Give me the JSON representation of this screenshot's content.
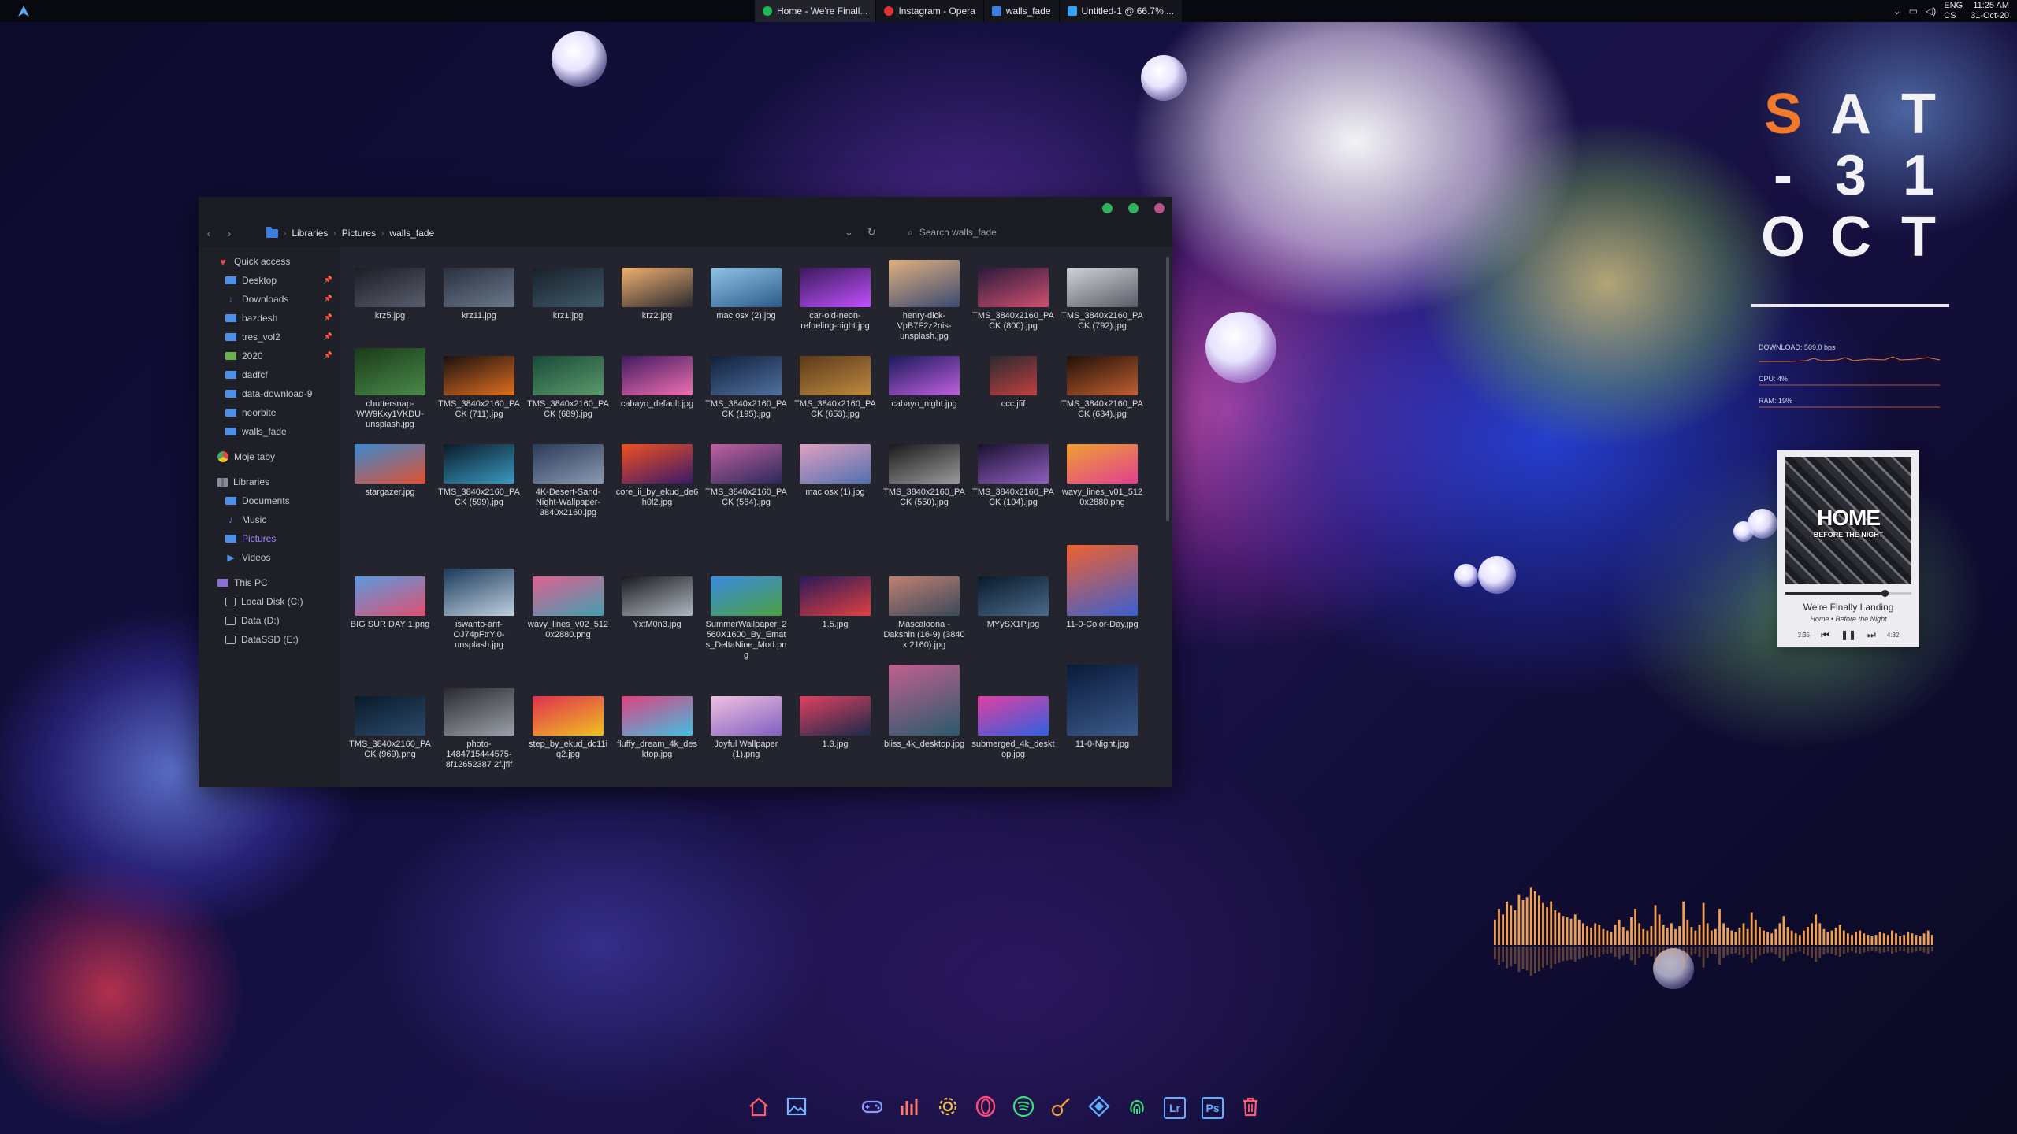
{
  "taskbar": {
    "tasks": [
      {
        "label": "Home - We're Finall...",
        "icon": "spotify-icon",
        "color": "#1db954"
      },
      {
        "label": "Instagram - Opera",
        "icon": "opera-icon",
        "color": "#e0322f"
      },
      {
        "label": "walls_fade",
        "icon": "folder-icon",
        "color": "#3b7fe0"
      },
      {
        "label": "Untitled-1 @ 66.7% ...",
        "icon": "photoshop-icon",
        "color": "#2fa3f7"
      }
    ],
    "lang_top": "ENG",
    "lang_bottom": "CS",
    "time": "11:25 AM",
    "date": "31-Oct-20"
  },
  "explorer": {
    "window_controls": [
      {
        "name": "minimize",
        "color": "#2fb35b"
      },
      {
        "name": "maximize",
        "color": "#2fb35b"
      },
      {
        "name": "close",
        "color": "#b8508a"
      }
    ],
    "breadcrumb": [
      "Libraries",
      "Pictures",
      "walls_fade"
    ],
    "search_placeholder": "Search walls_fade",
    "sidebar": [
      {
        "label": "Quick access",
        "kind": "heart",
        "level": 1
      },
      {
        "label": "Desktop",
        "kind": "folder",
        "level": 2,
        "pinned": true
      },
      {
        "label": "Downloads",
        "kind": "download",
        "level": 2,
        "pinned": true
      },
      {
        "label": "bazdesh",
        "kind": "folder",
        "level": 2,
        "pinned": true
      },
      {
        "label": "tres_vol2",
        "kind": "folder",
        "level": 2,
        "pinned": true
      },
      {
        "label": "2020",
        "kind": "image-folder",
        "level": 2,
        "pinned": true
      },
      {
        "label": "dadfcf",
        "kind": "folder",
        "level": 2
      },
      {
        "label": "data-download-9",
        "kind": "folder",
        "level": 2
      },
      {
        "label": "neorbite",
        "kind": "folder",
        "level": 2
      },
      {
        "label": "walls_fade",
        "kind": "folder",
        "level": 2
      },
      {
        "label": "Moje taby",
        "kind": "moje",
        "level": 1,
        "gap": true
      },
      {
        "label": "Libraries",
        "kind": "library",
        "level": 1,
        "gap": true
      },
      {
        "label": "Documents",
        "kind": "folder",
        "level": 2
      },
      {
        "label": "Music",
        "kind": "music",
        "level": 2
      },
      {
        "label": "Pictures",
        "kind": "folder",
        "level": 2,
        "selected": true
      },
      {
        "label": "Videos",
        "kind": "video",
        "level": 2
      },
      {
        "label": "This PC",
        "kind": "pc",
        "level": 1,
        "gap": true
      },
      {
        "label": "Local Disk (C:)",
        "kind": "drive",
        "level": 2
      },
      {
        "label": "Data (D:)",
        "kind": "drive",
        "level": 2
      },
      {
        "label": "DataSSD (E:)",
        "kind": "drive",
        "level": 2
      }
    ],
    "files": [
      {
        "name": "krz5.jpg",
        "c1": "#1b1d24",
        "c2": "#5a5f6e",
        "w": 90,
        "h": 50
      },
      {
        "name": "krz11.jpg",
        "c1": "#2a3040",
        "c2": "#6b7a8a",
        "w": 90,
        "h": 50
      },
      {
        "name": "krz1.jpg",
        "c1": "#18202a",
        "c2": "#3f5a6a",
        "w": 90,
        "h": 50
      },
      {
        "name": "krz2.jpg",
        "c1": "#f0b070",
        "c2": "#2a2a30",
        "w": 90,
        "h": 50
      },
      {
        "name": "mac osx (2).jpg",
        "c1": "#8fc4e6",
        "c2": "#2c5a8a",
        "w": 90,
        "h": 50
      },
      {
        "name": "car-old-neon-refueling-night.jpg",
        "c1": "#3a1a5a",
        "c2": "#c050ff",
        "w": 90,
        "h": 50
      },
      {
        "name": "henry-dick-VpB7F2z2nis-unsplash.jpg",
        "c1": "#e0b080",
        "c2": "#3a4a70",
        "w": 90,
        "h": 60
      },
      {
        "name": "TMS_3840x2160_PACK (800).jpg",
        "c1": "#2a1a3a",
        "c2": "#d05070",
        "w": 90,
        "h": 50
      },
      {
        "name": "TMS_3840x2160_PACK (792).jpg",
        "c1": "#cfd2d8",
        "c2": "#5a5c66",
        "w": 90,
        "h": 50
      },
      {
        "name": "chuttersnap-WW9Kxy1VKDU-unsplash.jpg",
        "c1": "#1a3a1a",
        "c2": "#4a8a4a",
        "w": 90,
        "h": 60
      },
      {
        "name": "TMS_3840x2160_PACK (711).jpg",
        "c1": "#1a1010",
        "c2": "#e07020",
        "w": 90,
        "h": 50
      },
      {
        "name": "TMS_3840x2160_PACK (689).jpg",
        "c1": "#1a4a3a",
        "c2": "#5a9a6a",
        "w": 90,
        "h": 50
      },
      {
        "name": "cabayo_default.jpg",
        "c1": "#401a60",
        "c2": "#f070b0",
        "w": 90,
        "h": 50
      },
      {
        "name": "TMS_3840x2160_PACK (195).jpg",
        "c1": "#10203a",
        "c2": "#5070a0",
        "w": 90,
        "h": 50
      },
      {
        "name": "TMS_3840x2160_PACK (653).jpg",
        "c1": "#5a3a1a",
        "c2": "#c08a40",
        "w": 90,
        "h": 50
      },
      {
        "name": "cabayo_night.jpg",
        "c1": "#1a1a5a",
        "c2": "#c060e0",
        "w": 90,
        "h": 50
      },
      {
        "name": "ccc.jfif",
        "c1": "#2a2a30",
        "c2": "#c04040",
        "w": 60,
        "h": 50
      },
      {
        "name": "TMS_3840x2160_PACK (634).jpg",
        "c1": "#201008",
        "c2": "#c06030",
        "w": 90,
        "h": 50
      },
      {
        "name": "stargazer.jpg",
        "c1": "#3a8ad0",
        "c2": "#e05030",
        "w": 90,
        "h": 50
      },
      {
        "name": "TMS_3840x2160_PACK (599).jpg",
        "c1": "#0a1a2a",
        "c2": "#3a9ac0",
        "w": 90,
        "h": 50
      },
      {
        "name": "4K-Desert-Sand-Night-Wallpaper-3840x2160.jpg",
        "c1": "#2a3a5a",
        "c2": "#8a9ab0",
        "w": 90,
        "h": 50
      },
      {
        "name": "core_ii_by_ekud_de6h0l2.jpg",
        "c1": "#f05020",
        "c2": "#3a1a6a",
        "w": 90,
        "h": 50
      },
      {
        "name": "TMS_3840x2160_PACK (564).jpg",
        "c1": "#c060a0",
        "c2": "#2a2a5a",
        "w": 90,
        "h": 50
      },
      {
        "name": "mac osx (1).jpg",
        "c1": "#e0a0c0",
        "c2": "#5070b0",
        "w": 90,
        "h": 50
      },
      {
        "name": "TMS_3840x2160_PACK (550).jpg",
        "c1": "#1a1a1a",
        "c2": "#9a9a9a",
        "w": 90,
        "h": 50
      },
      {
        "name": "TMS_3840x2160_PACK (104).jpg",
        "c1": "#1a1030",
        "c2": "#9060c0",
        "w": 90,
        "h": 50
      },
      {
        "name": "wavy_lines_v01_5120x2880.png",
        "c1": "#f0a030",
        "c2": "#e04090",
        "w": 90,
        "h": 50
      },
      {
        "name": "BIG SUR DAY 1.png",
        "c1": "#5a9ae0",
        "c2": "#e05070",
        "w": 90,
        "h": 50
      },
      {
        "name": "iswanto-arif-OJ74pFtrYi0-unsplash.jpg",
        "c1": "#1a3a5a",
        "c2": "#c0d0e0",
        "w": 90,
        "h": 60
      },
      {
        "name": "wavy_lines_v02_5120x2880.png",
        "c1": "#e06090",
        "c2": "#40a0b0",
        "w": 90,
        "h": 50
      },
      {
        "name": "YxtM0n3.jpg",
        "c1": "#1a1a20",
        "c2": "#b0b8c0",
        "w": 90,
        "h": 50
      },
      {
        "name": "SummerWallpaper_2560X1600_By_Emats_DeltaNine_Mod.png",
        "c1": "#3a8ae0",
        "c2": "#4aa040",
        "w": 90,
        "h": 50
      },
      {
        "name": "1.5.jpg",
        "c1": "#2a1a5a",
        "c2": "#e04040",
        "w": 90,
        "h": 50
      },
      {
        "name": "Mascaloona - Dakshin (16-9) (3840 x 2160).jpg",
        "c1": "#c08070",
        "c2": "#3a4a5a",
        "w": 90,
        "h": 50
      },
      {
        "name": "MYySX1P.jpg",
        "c1": "#0a1a2a",
        "c2": "#4a6a8a",
        "w": 90,
        "h": 50
      },
      {
        "name": "11-0-Color-Day.jpg",
        "c1": "#f06030",
        "c2": "#3a60d0",
        "w": 90,
        "h": 90
      },
      {
        "name": "TMS_3840x2160_PACK (969).png",
        "c1": "#0a1a2a",
        "c2": "#2a4a6a",
        "w": 90,
        "h": 50
      },
      {
        "name": "photo-1484715444575-8f12652387 2f.jfif",
        "c1": "#2a2a30",
        "c2": "#9aa0a8",
        "w": 90,
        "h": 60
      },
      {
        "name": "step_by_ekud_dc11iq2.jpg",
        "c1": "#e03050",
        "c2": "#f0c020",
        "w": 90,
        "h": 50
      },
      {
        "name": "fluffy_dream_4k_desktop.jpg",
        "c1": "#e04080",
        "c2": "#40c0e0",
        "w": 90,
        "h": 50
      },
      {
        "name": "Joyful Wallpaper (1).png",
        "c1": "#f0c0e0",
        "c2": "#8060c0",
        "w": 90,
        "h": 50
      },
      {
        "name": "1.3.jpg",
        "c1": "#e04060",
        "c2": "#1a2a4a",
        "w": 90,
        "h": 50
      },
      {
        "name": "bliss_4k_desktop.jpg",
        "c1": "#c06090",
        "c2": "#2a5a6a",
        "w": 90,
        "h": 90
      },
      {
        "name": "submerged_4k_desktop.jpg",
        "c1": "#e040a0",
        "c2": "#3060e0",
        "w": 90,
        "h": 50
      },
      {
        "name": "11-0-Night.jpg",
        "c1": "#0a1a3a",
        "c2": "#3a5a8a",
        "w": 90,
        "h": 90
      }
    ]
  },
  "clock_widget": {
    "rows": [
      [
        "S",
        "A",
        "T"
      ],
      [
        "-",
        "3",
        "1"
      ],
      [
        "O",
        "C",
        "T"
      ]
    ],
    "accent_color": "#f07a2a"
  },
  "system_monitor": {
    "download": "DOWNLOAD: 509.0 bps",
    "cpu": "CPU: 4%",
    "ram": "RAM: 19%"
  },
  "music_player": {
    "album_title": "HOME",
    "album_subtitle": "BEFORE THE NIGHT",
    "song": "We're Finally Landing",
    "artist": "Home • Before the Night",
    "elapsed": "3:35",
    "total": "4:32",
    "progress": 0.79
  },
  "visualizer": {
    "color": "#f0a050",
    "levels": [
      0.35,
      0.5,
      0.42,
      0.6,
      0.55,
      0.48,
      0.7,
      0.62,
      0.66,
      0.8,
      0.74,
      0.68,
      0.58,
      0.52,
      0.6,
      0.48,
      0.45,
      0.4,
      0.38,
      0.36,
      0.42,
      0.35,
      0.3,
      0.26,
      0.24,
      0.3,
      0.28,
      0.22,
      0.2,
      0.18,
      0.28,
      0.35,
      0.25,
      0.2,
      0.38,
      0.5,
      0.3,
      0.22,
      0.2,
      0.26,
      0.55,
      0.42,
      0.28,
      0.24,
      0.3,
      0.22,
      0.26,
      0.6,
      0.35,
      0.25,
      0.2,
      0.28,
      0.58,
      0.3,
      0.2,
      0.22,
      0.5,
      0.3,
      0.24,
      0.2,
      0.18,
      0.24,
      0.3,
      0.22,
      0.45,
      0.35,
      0.25,
      0.2,
      0.18,
      0.16,
      0.22,
      0.3,
      0.4,
      0.25,
      0.2,
      0.16,
      0.14,
      0.2,
      0.25,
      0.3,
      0.42,
      0.3,
      0.22,
      0.18,
      0.2,
      0.24,
      0.28,
      0.2,
      0.16,
      0.14,
      0.18,
      0.2,
      0.16,
      0.14,
      0.12,
      0.14,
      0.18,
      0.16,
      0.14,
      0.2,
      0.16,
      0.12,
      0.14,
      0.18,
      0.16,
      0.14,
      0.12,
      0.16,
      0.2,
      0.14
    ]
  },
  "dock": [
    {
      "name": "home-icon",
      "color": "#ff5a6e"
    },
    {
      "name": "photos-icon",
      "color": "#7ab6ff"
    },
    {
      "name": "messenger-icon",
      "color": "#3ad6a0"
    },
    {
      "name": "gamepad-icon",
      "color": "#8a9cff"
    },
    {
      "name": "stats-icon",
      "color": "#ff7a6a"
    },
    {
      "name": "settings-icon",
      "color": "#f0c040"
    },
    {
      "name": "opera-icon",
      "color": "#ff4a7a"
    },
    {
      "name": "spotify-icon",
      "color": "#3ae07a"
    },
    {
      "name": "guitar-icon",
      "color": "#f0a040"
    },
    {
      "name": "kodi-icon",
      "color": "#5ab0ff"
    },
    {
      "name": "fingerprint-icon",
      "color": "#3ae07a"
    },
    {
      "name": "lightroom-icon",
      "color": "#6aa8ff",
      "text": "Lr"
    },
    {
      "name": "photoshop-icon",
      "color": "#5ab0ff",
      "text": "Ps"
    },
    {
      "name": "trash-icon",
      "color": "#ff5a6e"
    }
  ]
}
